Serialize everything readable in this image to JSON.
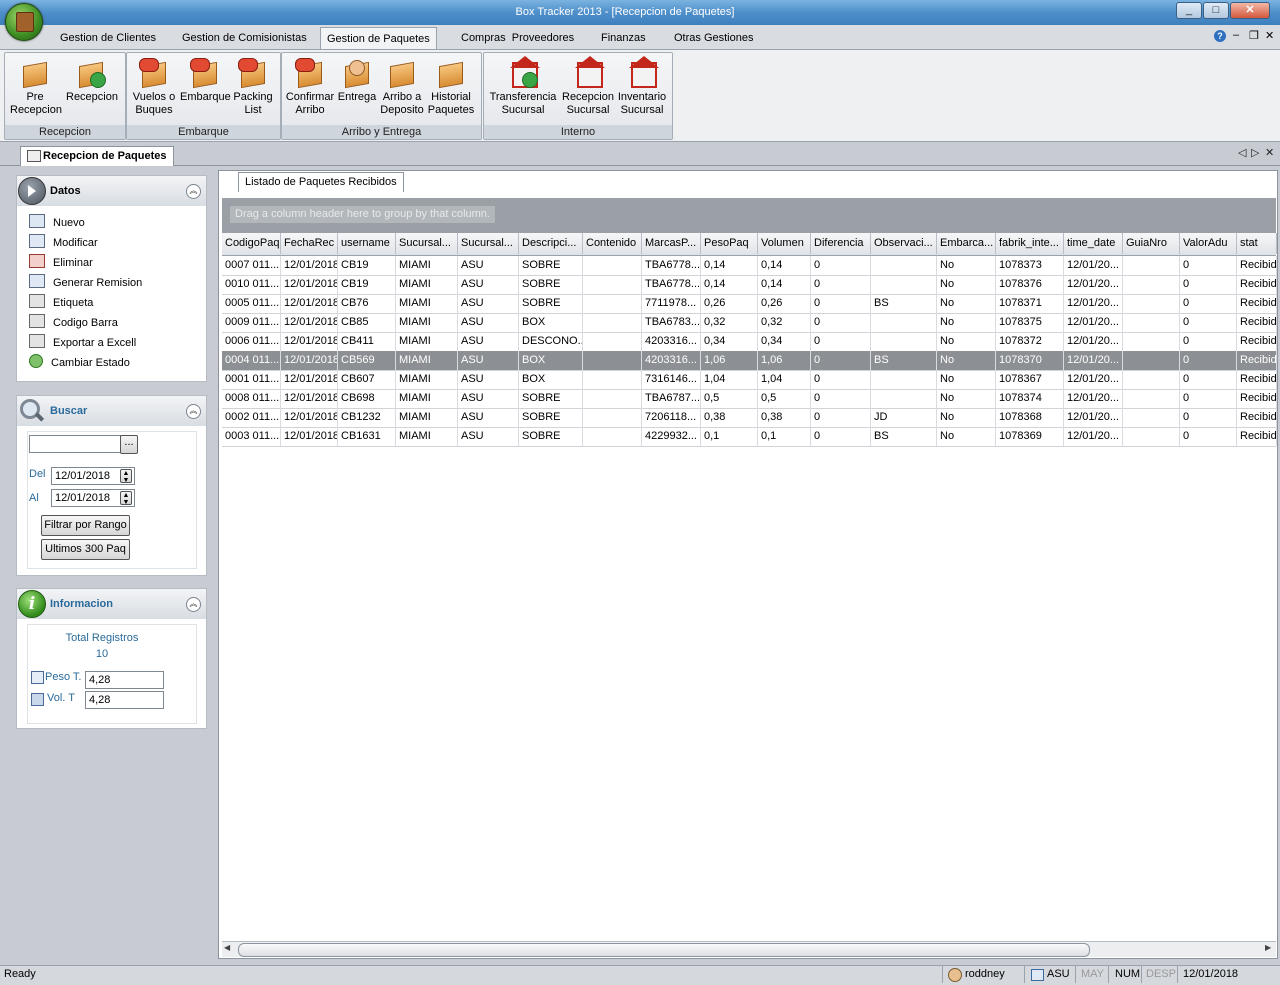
{
  "window": {
    "title": "Box Tracker 2013 - [Recepcion de Paquetes]",
    "min": "_",
    "max": "□",
    "close": "✕"
  },
  "menu": {
    "tabs": [
      "Gestion de Clientes",
      "Gestion de Comisionistas",
      "Gestion de Paquetes",
      "Compras  Proveedores",
      "Finanzas",
      "Otras Gestiones"
    ],
    "help": "?",
    "mdi_min": "–",
    "mdi_restore": "❐",
    "mdi_close": "✕"
  },
  "ribbon": {
    "groups": [
      {
        "label": "Recepcion",
        "buttons": [
          {
            "l1": "Pre",
            "l2": "Recepcion"
          },
          {
            "l1": "Recepcion",
            "l2": ""
          }
        ]
      },
      {
        "label": "Embarque",
        "buttons": [
          {
            "l1": "Vuelos o",
            "l2": "Buques"
          },
          {
            "l1": "Embarque",
            "l2": ""
          },
          {
            "l1": "Packing",
            "l2": "List"
          }
        ]
      },
      {
        "label": "Arribo y Entrega",
        "buttons": [
          {
            "l1": "Confirmar",
            "l2": "Arribo"
          },
          {
            "l1": "Entrega",
            "l2": ""
          },
          {
            "l1": "Arribo a",
            "l2": "Deposito"
          },
          {
            "l1": "Historial",
            "l2": "Paquetes"
          }
        ]
      },
      {
        "label": "Interno",
        "buttons": [
          {
            "l1": "Transferencia",
            "l2": "Sucursal"
          },
          {
            "l1": "Recepcion",
            "l2": "Sucursal"
          },
          {
            "l1": "Inventario",
            "l2": "Sucursal"
          }
        ]
      }
    ]
  },
  "doc_tab": {
    "label": "Recepcion de Paquetes",
    "prev": "◁",
    "next": "▷",
    "close": "✕"
  },
  "datos": {
    "title": "Datos",
    "items": [
      "Nuevo",
      "Modificar",
      "Eliminar",
      "Generar Remision",
      "Etiqueta",
      "Codigo Barra",
      "Exportar a Excell",
      "Cambiar Estado"
    ]
  },
  "buscar": {
    "title": "Buscar",
    "search_value": "",
    "ellipsis": "...",
    "del_label": "Del",
    "del_value": "12/01/2018",
    "al_label": "Al",
    "al_value": "12/01/2018",
    "filter_button": "Filtrar por Rango",
    "last_button": "Ultimos 300 Paq"
  },
  "informacion": {
    "title": "Informacion",
    "total_label": "Total Registros",
    "total_value": "10",
    "peso_label": "Peso T.",
    "peso_value": "4,28",
    "vol_label": "Vol. T",
    "vol_value": "4,28"
  },
  "grid": {
    "tab_label": "Listado de Paquetes Recibidos",
    "group_hint": "Drag a column header here to group by that column.",
    "columns": [
      "CodigoPaq",
      "FechaRec",
      "username",
      "Sucursal...",
      "Sucursal...",
      "Descripci...",
      "Contenido",
      "MarcasP...",
      "PesoPaq",
      "Volumen",
      "Diferencia",
      "Observaci...",
      "Embarca...",
      "fabrik_inte...",
      "time_date",
      "GuiaNro",
      "ValorAdu",
      "stat"
    ],
    "rows": [
      [
        "0007 011...",
        "12/01/2018",
        "CB19",
        "MIAMI",
        "ASU",
        "SOBRE",
        "",
        "TBA6778...",
        "0,14",
        "0,14",
        "0",
        "",
        "No",
        "1078373",
        "12/01/20...",
        "",
        "0",
        "Recibid"
      ],
      [
        "0010 011...",
        "12/01/2018",
        "CB19",
        "MIAMI",
        "ASU",
        "SOBRE",
        "",
        "TBA6778...",
        "0,14",
        "0,14",
        "0",
        "",
        "No",
        "1078376",
        "12/01/20...",
        "",
        "0",
        "Recibid"
      ],
      [
        "0005 011...",
        "12/01/2018",
        "CB76",
        "MIAMI",
        "ASU",
        "SOBRE",
        "",
        "7711978...",
        "0,26",
        "0,26",
        "0",
        "BS",
        "No",
        "1078371",
        "12/01/20...",
        "",
        "0",
        "Recibid"
      ],
      [
        "0009 011...",
        "12/01/2018",
        "CB85",
        "MIAMI",
        "ASU",
        "BOX",
        "",
        "TBA6783...",
        "0,32",
        "0,32",
        "0",
        "",
        "No",
        "1078375",
        "12/01/20...",
        "",
        "0",
        "Recibid"
      ],
      [
        "0006 011...",
        "12/01/2018",
        "CB411",
        "MIAMI",
        "ASU",
        "DESCONO...",
        "",
        "4203316...",
        "0,34",
        "0,34",
        "0",
        "",
        "No",
        "1078372",
        "12/01/20...",
        "",
        "0",
        "Recibid"
      ],
      [
        "0004 011...",
        "12/01/2018",
        "CB569",
        "MIAMI",
        "ASU",
        "BOX",
        "",
        "4203316...",
        "1,06",
        "1,06",
        "0",
        "BS",
        "No",
        "1078370",
        "12/01/20...",
        "",
        "0",
        "Recibid"
      ],
      [
        "0001 011...",
        "12/01/2018",
        "CB607",
        "MIAMI",
        "ASU",
        "BOX",
        "",
        "7316146...",
        "1,04",
        "1,04",
        "0",
        "",
        "No",
        "1078367",
        "12/01/20...",
        "",
        "0",
        "Recibid"
      ],
      [
        "0008 011...",
        "12/01/2018",
        "CB698",
        "MIAMI",
        "ASU",
        "SOBRE",
        "",
        "TBA6787...",
        "0,5",
        "0,5",
        "0",
        "",
        "No",
        "1078374",
        "12/01/20...",
        "",
        "0",
        "Recibid"
      ],
      [
        "0002 011...",
        "12/01/2018",
        "CB1232",
        "MIAMI",
        "ASU",
        "SOBRE",
        "",
        "7206118...",
        "0,38",
        "0,38",
        "0",
        "JD",
        "No",
        "1078368",
        "12/01/20...",
        "",
        "0",
        "Recibid"
      ],
      [
        "0003 011...",
        "12/01/2018",
        "CB1631",
        "MIAMI",
        "ASU",
        "SOBRE",
        "",
        "4229932...",
        "0,1",
        "0,1",
        "0",
        "BS",
        "No",
        "1078369",
        "12/01/20...",
        "",
        "0",
        "Recibid"
      ]
    ],
    "selected_row": 5,
    "scroll_left": "◀",
    "scroll_right": "▶"
  },
  "status": {
    "ready": "Ready",
    "user": "roddney",
    "branch": "ASU",
    "caps": "MAY",
    "num": "NUM",
    "scroll": "DESP",
    "date": "12/01/2018"
  },
  "colors": {
    "titlebar": "#4e8fca",
    "selected_row": "#8c8f93",
    "panel_title": "#2a6a9a"
  }
}
